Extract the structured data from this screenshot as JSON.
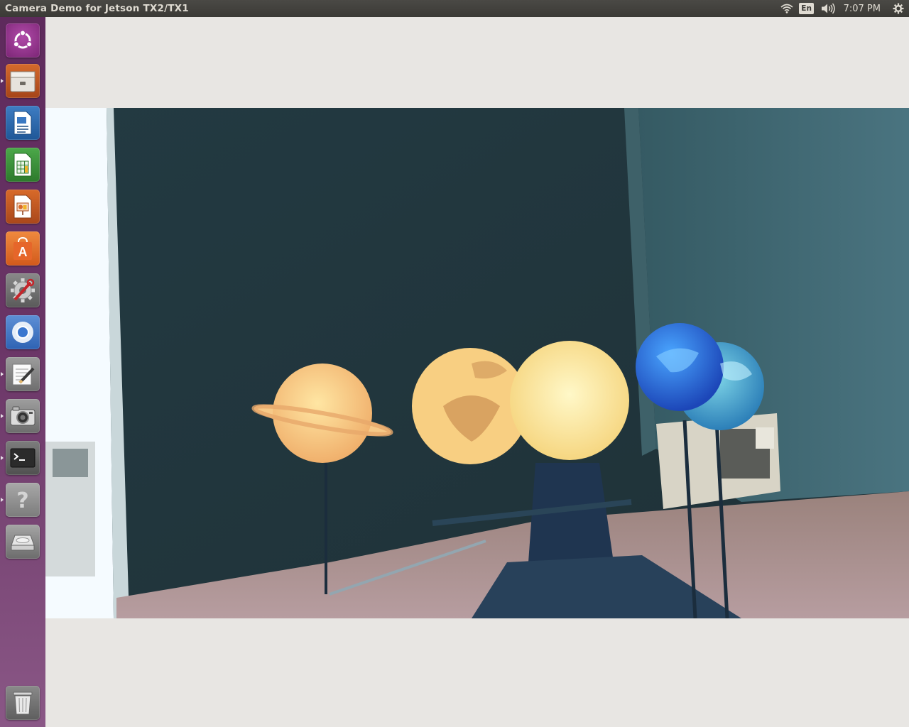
{
  "panel": {
    "window_title": "Camera Demo for Jetson TX2/TX1",
    "keyboard_layout": "En",
    "clock": "7:07 PM",
    "icons": [
      "wifi-icon",
      "keyboard-layout-indicator",
      "volume-icon",
      "system-gear-icon"
    ]
  },
  "launcher": {
    "items": [
      {
        "name": "dash-home",
        "icon": "ubuntu-logo-icon"
      },
      {
        "name": "files",
        "icon": "file-cabinet-icon",
        "running": true
      },
      {
        "name": "writer",
        "icon": "document-icon"
      },
      {
        "name": "calc",
        "icon": "spreadsheet-icon"
      },
      {
        "name": "impress",
        "icon": "presentation-icon"
      },
      {
        "name": "software-center",
        "icon": "shopping-bag-icon"
      },
      {
        "name": "system-settings",
        "icon": "wrench-gear-icon"
      },
      {
        "name": "chromium",
        "icon": "browser-icon"
      },
      {
        "name": "text-editor",
        "icon": "pencil-notepad-icon",
        "running": true
      },
      {
        "name": "camera-demo",
        "icon": "camera-icon",
        "running": true
      },
      {
        "name": "terminal",
        "icon": "terminal-icon",
        "running": true
      },
      {
        "name": "help",
        "icon": "question-mark-icon",
        "running": true
      },
      {
        "name": "drive",
        "icon": "hard-drive-icon"
      },
      {
        "name": "trash",
        "icon": "trash-icon"
      }
    ]
  },
  "colors": {
    "panel_bg": "#3b3a36",
    "launcher_bg": "#6a3566",
    "window_bg": "#e8e6e3"
  }
}
